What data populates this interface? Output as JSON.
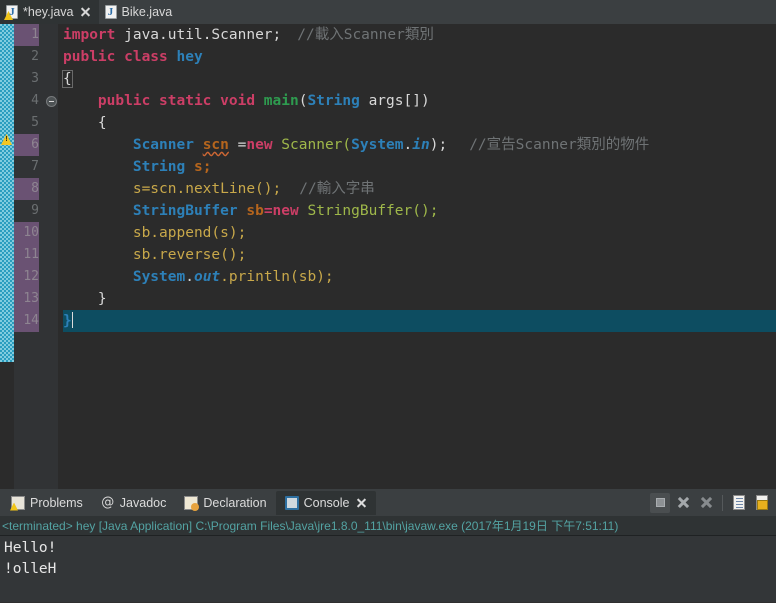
{
  "tabs": [
    {
      "label": "*hey.java",
      "icon": "java-file-icon",
      "active": true,
      "warning": true,
      "closable": true
    },
    {
      "label": "Bike.java",
      "icon": "java-file-icon",
      "active": false,
      "warning": false,
      "closable": false
    }
  ],
  "editor": {
    "lines": [
      {
        "num": "1",
        "changed": true
      },
      {
        "num": "2",
        "changed": false
      },
      {
        "num": "3",
        "changed": false
      },
      {
        "num": "4",
        "changed": false
      },
      {
        "num": "5",
        "changed": false
      },
      {
        "num": "6",
        "changed": true
      },
      {
        "num": "7",
        "changed": false
      },
      {
        "num": "8",
        "changed": true
      },
      {
        "num": "9",
        "changed": false
      },
      {
        "num": "10",
        "changed": true
      },
      {
        "num": "11",
        "changed": true
      },
      {
        "num": "12",
        "changed": true
      },
      {
        "num": "13",
        "changed": true
      },
      {
        "num": "14",
        "changed": true
      }
    ],
    "code": {
      "l1_kw": "import",
      "l1_pkg": " java.util.Scanner;",
      "l1_cmt": "//載入Scanner類別",
      "l2_kw": "public class",
      "l2_name": " hey",
      "l3": "{",
      "l4_kw": "public static void",
      "l4_meth": "main",
      "l4_p1": "(",
      "l4_type": "String",
      "l4_arg": " args[])",
      "l5": "{",
      "l6_type": "Scanner",
      "l6_var": "scn",
      "l6_eq": " =",
      "l6_new": "new",
      "l6_ctor": " Scanner(",
      "l6_sys": "System",
      "l6_dot": ".",
      "l6_in": "in",
      "l6_end": ");",
      "l6_cmt": "//宣告Scanner類別的物件",
      "l7_type": "String",
      "l7_var": " s;",
      "l8_stmt": "s=scn.nextLine();",
      "l8_cmt": "//輸入字串",
      "l9_type": "StringBuffer",
      "l9_var": " sb",
      "l9_eq": "=",
      "l9_new": "new",
      "l9_ctor": " StringBuffer();",
      "l10": "sb.append(s);",
      "l11": "sb.reverse();",
      "l12_sys": "System",
      "l12_d1": ".",
      "l12_out": "out",
      "l12_rest": ".println(sb);",
      "l13": "}",
      "l14": "}"
    }
  },
  "panel": {
    "tabs": [
      {
        "label": "Problems",
        "icon": "problems-icon",
        "active": false,
        "closable": false
      },
      {
        "label": "Javadoc",
        "icon": "javadoc-icon",
        "active": false,
        "closable": false
      },
      {
        "label": "Declaration",
        "icon": "declaration-icon",
        "active": false,
        "closable": false
      },
      {
        "label": "Console",
        "icon": "console-icon",
        "active": true,
        "closable": true
      }
    ],
    "tools": [
      {
        "name": "terminate-button",
        "icon": "stop-square-icon"
      },
      {
        "name": "remove-launch-button",
        "icon": "close-x-icon"
      },
      {
        "name": "remove-all-button",
        "icon": "close-all-x-icon"
      },
      {
        "name": "clear-console-button",
        "icon": "clear-document-icon"
      },
      {
        "name": "scroll-lock-button",
        "icon": "lock-document-icon"
      }
    ],
    "status": "<terminated> hey [Java Application] C:\\Program Files\\Java\\jre1.8.0_111\\bin\\javaw.exe (2017年1月19日 下午7:51:11)",
    "output": [
      "Hello!",
      "!olleH"
    ]
  },
  "colors": {
    "editor_bg": "#2b2b2b",
    "gutter_bg": "#313335",
    "changed_line": "#6a5273",
    "current_line": "#0d4d61",
    "keyword": "#cc3e66",
    "type": "#2d80b8",
    "method": "#2e9b4f",
    "comment": "#6f7375",
    "string_literal": "#9fb84a",
    "console_status": "#53a3a3",
    "panel_bg": "#3b3f41"
  }
}
